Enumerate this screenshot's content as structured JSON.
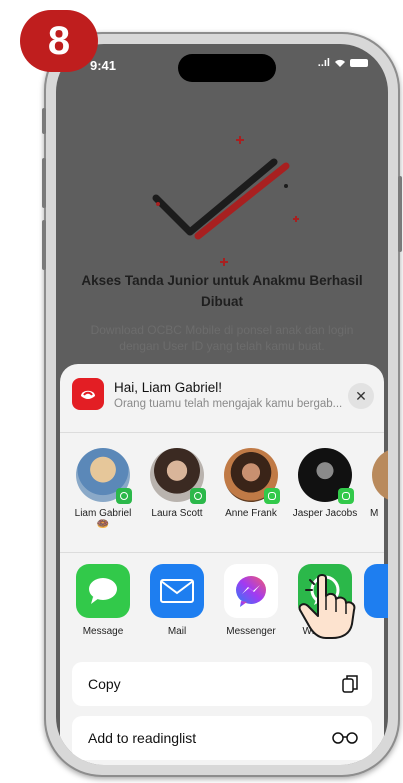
{
  "step": {
    "number": "8"
  },
  "status_bar": {
    "time": "9:41",
    "signal": "..ıl"
  },
  "background_page": {
    "title": "Akses Tanda Junior untuk Anakmu Berhasil Dibuat",
    "description": "Download OCBC Mobile di ponsel anak dan login dengan User ID yang telah kamu buat."
  },
  "share_sheet": {
    "title": "Hai, Liam Gabriel!",
    "subtitle": "Orang tuamu telah mengajak kamu bergab...",
    "close_label": "✕",
    "people": [
      {
        "name": "Liam Gabriel 🍩",
        "color": "#c7a57e"
      },
      {
        "name": "Laura Scott",
        "color": "#8a7466"
      },
      {
        "name": "Anne Frank",
        "color": "#9b6b3c"
      },
      {
        "name": "Jasper Jacobs",
        "color": "#2d2d2d"
      },
      {
        "name": "M",
        "color": "#b98a5c"
      }
    ],
    "apps": [
      {
        "label": "Message",
        "icon": "message-icon",
        "color": "#32c94a"
      },
      {
        "label": "Mail",
        "icon": "mail-icon",
        "color": "#1e7ef0"
      },
      {
        "label": "Messenger",
        "icon": "messenger-icon",
        "color": "#ffffff"
      },
      {
        "label": "Whatsapp",
        "icon": "whatsapp-icon",
        "color": "#2bb84a"
      }
    ],
    "actions": [
      {
        "label": "Copy",
        "icon": "copy-icon"
      },
      {
        "label": "Add to readinglist",
        "icon": "glasses-icon"
      }
    ]
  },
  "colors": {
    "badge": "#bf1e1e",
    "accent_red": "#d32f2f",
    "brand_red": "#e31e24"
  }
}
